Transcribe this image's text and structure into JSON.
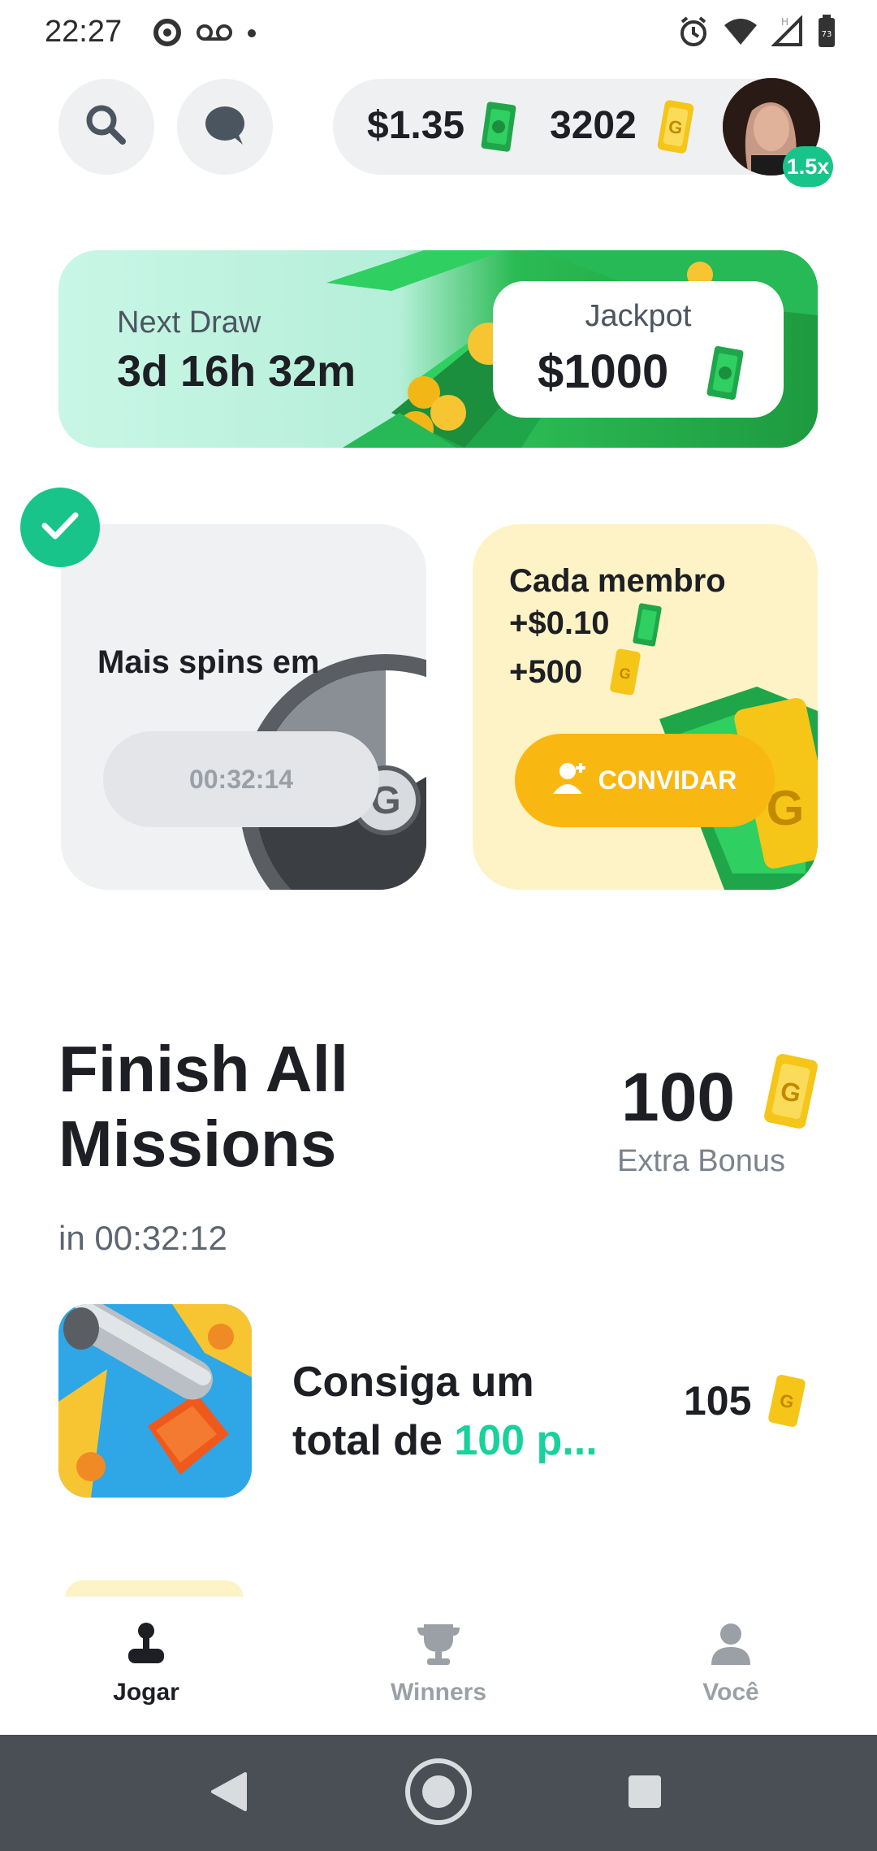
{
  "status_bar": {
    "time": "22:27",
    "battery_level": "73"
  },
  "header": {
    "cash_balance": "$1.35",
    "ticket_balance": "3202",
    "multiplier": "1.5x"
  },
  "draw": {
    "next_draw_label": "Next Draw",
    "next_draw_time": "3d 16h 32m",
    "jackpot_label": "Jackpot",
    "jackpot_value": "$1000"
  },
  "spin_card": {
    "title": "Mais spins em",
    "timer": "00:32:14"
  },
  "invite_card": {
    "line1": "Cada membro",
    "line2": "+$0.10",
    "line3": "+500",
    "button_label": "CONVIDAR"
  },
  "missions": {
    "title": "Finish All Missions",
    "timer": "in 00:32:12",
    "bonus_value": "100",
    "bonus_label": "Extra Bonus",
    "items": [
      {
        "text_line1": "Consiga um",
        "text_line2_prefix": "total de ",
        "text_line2_highlight": "100 p...",
        "reward": "105"
      }
    ]
  },
  "bottom_nav": {
    "items": [
      {
        "label": "Jogar",
        "icon": "joystick-icon",
        "active": true
      },
      {
        "label": "Winners",
        "icon": "trophy-icon",
        "active": false
      },
      {
        "label": "Você",
        "icon": "person-icon",
        "active": false
      }
    ]
  },
  "colors": {
    "accent_green": "#19c48b",
    "highlight_teal": "#19d19c",
    "invite_yellow": "#f9b712",
    "ticket_gold": "#f5c518",
    "cash_green": "#1fa64a"
  }
}
